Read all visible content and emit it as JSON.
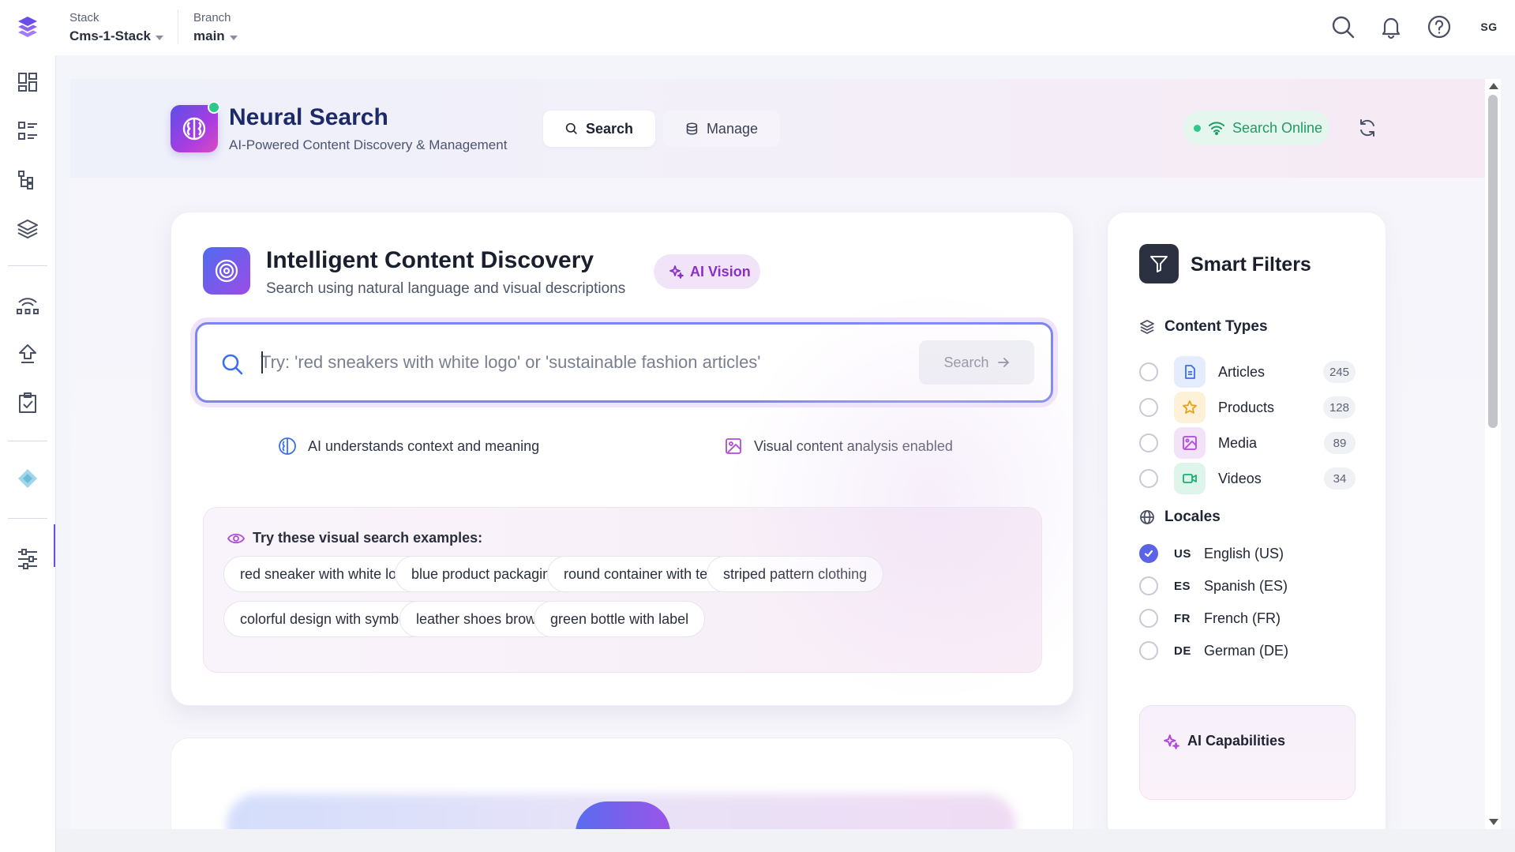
{
  "topbar": {
    "stack_label": "Stack",
    "stack_value": "Cms-1-Stack",
    "branch_label": "Branch",
    "branch_value": "main",
    "avatar_initials": "SG",
    "icons": [
      "search-icon",
      "bell-icon",
      "help-icon"
    ]
  },
  "leftnav": {
    "items": [
      "dashboard-icon",
      "content-list-icon",
      "content-models-icon",
      "stack-layers-icon",
      "releases-icon",
      "deploy-icon",
      "tasks-icon",
      "extension-icon",
      "settings-sliders-icon"
    ],
    "active": "extension-icon"
  },
  "app": {
    "title": "Neural Search",
    "subtitle": "AI-Powered Content Discovery & Management",
    "tabs": [
      {
        "label": "Search",
        "icon": "search-icon",
        "active": true
      },
      {
        "label": "Manage",
        "icon": "database-icon",
        "active": false
      }
    ],
    "status": "Search Online",
    "status_color": "#1e9c62"
  },
  "discovery": {
    "title": "Intelligent Content Discovery",
    "subtitle": "Search using natural language and visual descriptions",
    "badge": "AI Vision",
    "search": {
      "placeholder": "Try: 'red sneakers with white logo' or 'sustainable fashion articles'",
      "value": "",
      "button_label": "Search"
    },
    "features": [
      "AI understands context and meaning",
      "Visual content analysis enabled"
    ],
    "examples_title": "Try these visual search examples:",
    "examples": [
      "red sneaker with white logo",
      "blue product packaging",
      "round container with text",
      "striped pattern clothing",
      "colorful design with symbols",
      "leather shoes brown",
      "green bottle with label"
    ]
  },
  "filters": {
    "title": "Smart Filters",
    "content_types_title": "Content Types",
    "content_types": [
      {
        "label": "Articles",
        "count": "245",
        "icon": "document-icon",
        "color": "#3a6ff0",
        "checked": false
      },
      {
        "label": "Products",
        "count": "128",
        "icon": "star-icon",
        "color": "#e8a21a",
        "checked": false
      },
      {
        "label": "Media",
        "count": "89",
        "icon": "image-icon",
        "color": "#b04ad8",
        "checked": false
      },
      {
        "label": "Videos",
        "count": "34",
        "icon": "video-icon",
        "color": "#1fae6e",
        "checked": false
      }
    ],
    "locales_title": "Locales",
    "locales": [
      {
        "code": "US",
        "label": "English (US)",
        "checked": true
      },
      {
        "code": "ES",
        "label": "Spanish (ES)",
        "checked": false
      },
      {
        "code": "FR",
        "label": "French (FR)",
        "checked": false
      },
      {
        "code": "DE",
        "label": "German (DE)",
        "checked": false
      }
    ],
    "ai_capabilities_title": "AI Capabilities"
  },
  "colors": {
    "accent": "#5b63e8",
    "brand_gradient_start": "#5b4fe8",
    "brand_gradient_end": "#d84bc2"
  }
}
